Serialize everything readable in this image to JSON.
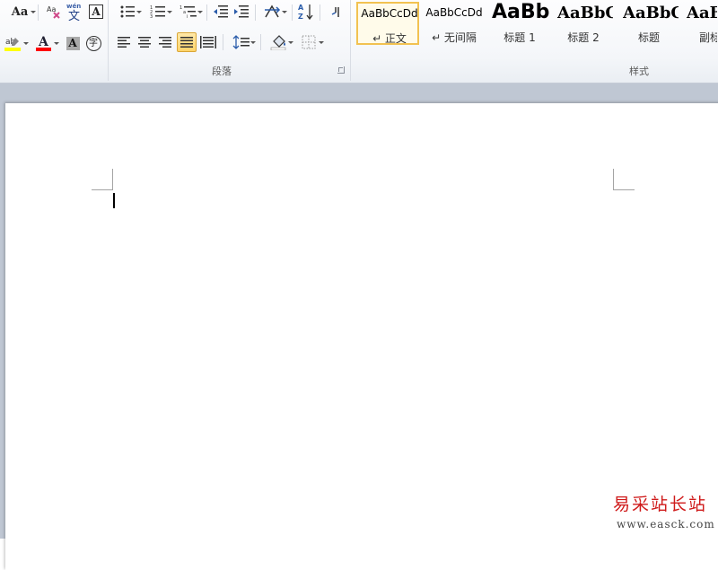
{
  "ribbon": {
    "groups": {
      "paragraph_label": "段落",
      "styles_label": "样式"
    },
    "font_tools": {
      "change_case_glyph": "Aa",
      "character_border_glyph": "A",
      "highlight_glyph": "ab",
      "font_color_glyph": "A",
      "character_shading_glyph": "A",
      "enclosed_char_glyph": "字",
      "phonetic_guide_top": "wén",
      "phonetic_guide_glyph": "文"
    },
    "styles": [
      {
        "preview": "AaBbCcDd",
        "name": "↵ 正文",
        "selected": true
      },
      {
        "preview": "AaBbCcDd",
        "name": "↵ 无间隔",
        "selected": false
      },
      {
        "preview": "AaBb",
        "name": "标题 1",
        "selected": false
      },
      {
        "preview": "AaBbC",
        "name": "标题 2",
        "selected": false
      },
      {
        "preview": "AaBbC",
        "name": "标题",
        "selected": false
      },
      {
        "preview": "AaB",
        "name": "副标",
        "selected": false
      }
    ]
  },
  "colors": {
    "highlight": "#ffff00",
    "font_color": "#ff0000",
    "active_button": "#ffd46a",
    "selected_style_border": "#f2c251"
  },
  "watermark": {
    "title": "易采站长站",
    "url": "www.easck.com"
  }
}
